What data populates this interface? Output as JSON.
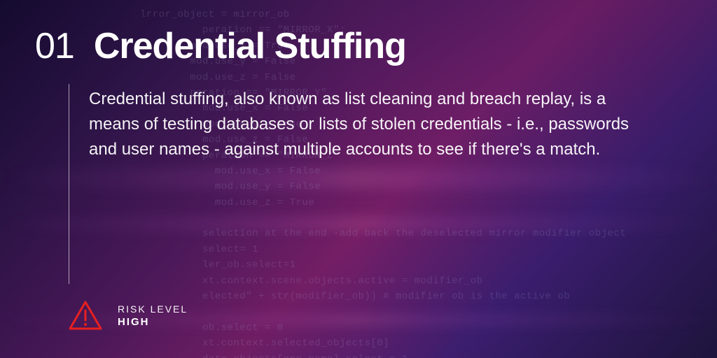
{
  "card": {
    "number": "01",
    "title": "Credential Stuffing",
    "description": "Credential stuffing, also known as list cleaning and breach replay, is a means of testing databases or lists of stolen credentials - i.e., passwords and user names - against multiple accounts to see if there's a match."
  },
  "risk": {
    "label": "RISK LEVEL",
    "value": "HIGH"
  },
  "background_code": "lrror_object = mirror_ob\n          peration == \"MIRROR_X\":\n        mod.use_x = True\n        mod.use_y = False\n        mod.use_z = False\n        peration == \"MIRROR_Y\"\n          mod.use_x = False\n          mod.use_y = True\n          mod.use_z = False\n          peration == \"MIRROR_Z\"\n            mod.use_x = False\n            mod.use_y = False\n            mod.use_z = True\n\n          selection at the end -add back the deselected mirror modifier object\n          select= 1\n          ler_ob.select=1\n          xt.context.scene.objects.active = modifier_ob\n          elected\" + str(modifier_ob)) # modifier ob is the active ob\n\n          ob.select = 0\n          xt.context.selected_objects[0]\n          data.objects[one.name].select = 1\n\n          print(\"please select exactly two objects, the last one gets the modifier unless it is a mirror\")\n\n          OPERATOR CLASSES ----\n\n\n               types.Operator):\n              X mirror to the selected object\"\"\"\n              ect.mirror_mirror_x\""
}
